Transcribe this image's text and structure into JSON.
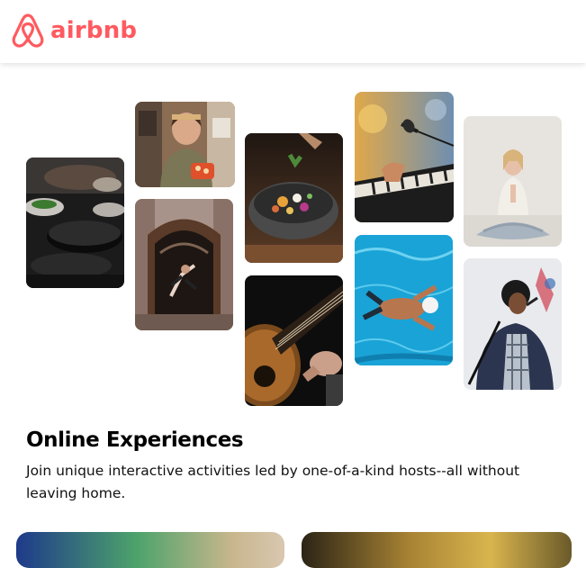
{
  "brand": {
    "name": "airbnb",
    "color": "#FF5A5F"
  },
  "section": {
    "title": "Online Experiences",
    "description": "Join unique interactive activities led by one-of-a-kind hosts--all without leaving home."
  },
  "gallery": [
    {
      "subject": "cooking pans"
    },
    {
      "subject": "chef with dish"
    },
    {
      "subject": "dancer in doorway"
    },
    {
      "subject": "bowl of food"
    },
    {
      "subject": "acoustic guitar"
    },
    {
      "subject": "keyboard and microphone"
    },
    {
      "subject": "swimmer in pool"
    },
    {
      "subject": "yoga meditation"
    },
    {
      "subject": "singer with microphone"
    }
  ]
}
